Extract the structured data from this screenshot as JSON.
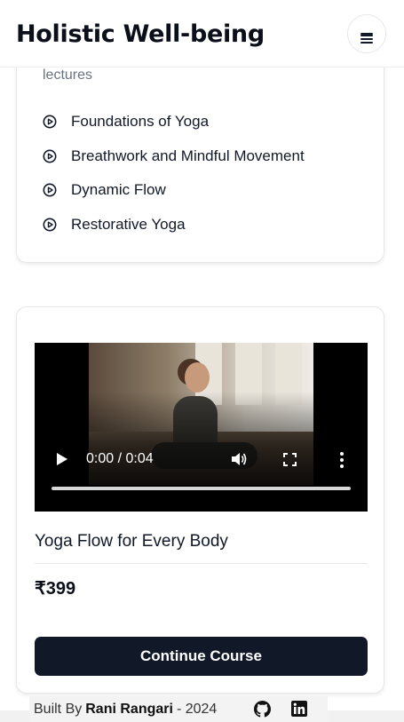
{
  "header": {
    "title": "Holistic Well-being",
    "menu_icon": "hamburger-menu-icon"
  },
  "curriculum": {
    "lectures_label": "lectures",
    "items": [
      {
        "label": "Foundations of Yoga",
        "icon": "play-circle-icon"
      },
      {
        "label": "Breathwork and Mindful Movement",
        "icon": "play-circle-icon"
      },
      {
        "label": "Dynamic Flow",
        "icon": "play-circle-icon"
      },
      {
        "label": "Restorative Yoga",
        "icon": "play-circle-icon"
      }
    ]
  },
  "course": {
    "video": {
      "time": "0:00 / 0:04",
      "progress": 0
    },
    "title": "Yoga Flow for Every Body",
    "price": "₹399",
    "cta_label": "Continue Course"
  },
  "footer": {
    "prefix": "Built By",
    "author": "Rani Rangari",
    "suffix": "- 2024",
    "icons": [
      "github-icon",
      "linkedin-icon"
    ]
  },
  "colors": {
    "primary": "#111827",
    "muted": "#6b7280",
    "border": "#e5e7eb"
  }
}
